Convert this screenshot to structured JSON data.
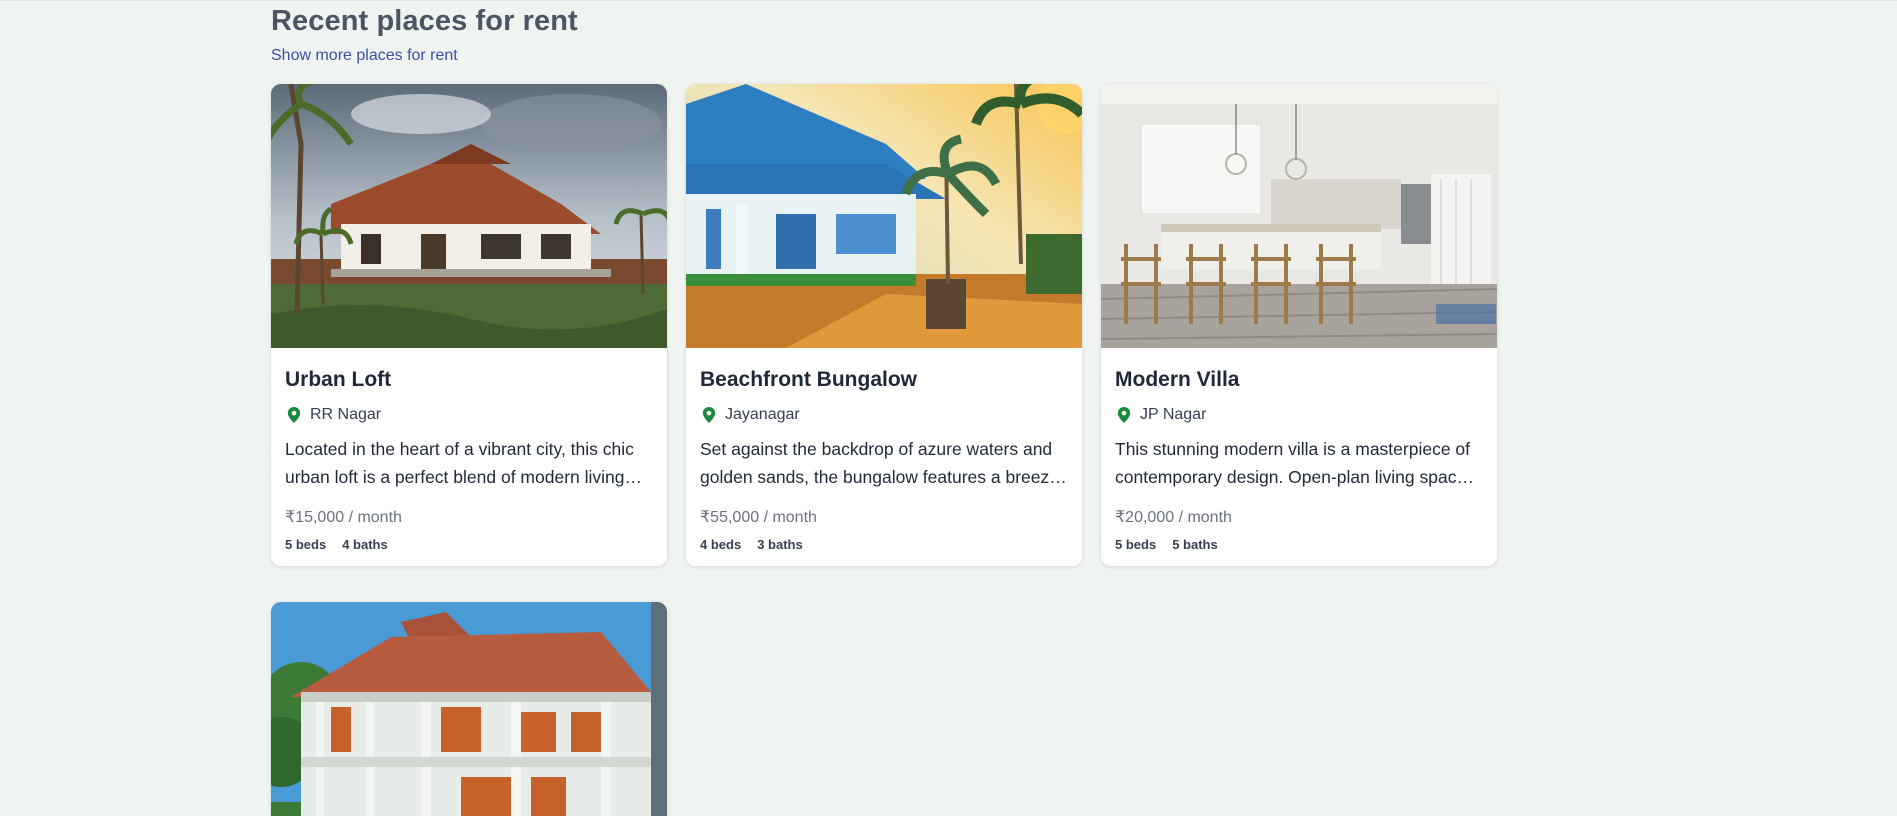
{
  "section": {
    "title": "Recent places for rent",
    "more_link": "Show more places for rent"
  },
  "listings": [
    {
      "title": "Urban Loft",
      "location": "RR Nagar",
      "description": "Located in the heart of a vibrant city, this chic urban loft is a perfect blend of modern living and industrial charm.",
      "price": "₹15,000 / month",
      "beds": "5 beds",
      "baths": "4 baths",
      "image": "tiled-roof-bungalow-photo"
    },
    {
      "title": "Beachfront Bungalow",
      "location": "Jayanagar",
      "description": "Set against the backdrop of azure waters and golden sands, the bungalow features a breezy veranda and lush gardens.",
      "price": "₹55,000 / month",
      "beds": "4 beds",
      "baths": "3 baths",
      "image": "blue-roof-cottage-photo"
    },
    {
      "title": "Modern Villa",
      "location": "JP Nagar",
      "description": "This stunning modern villa is a masterpiece of contemporary design. Open-plan living spaces with premium finishes.",
      "price": "₹20,000 / month",
      "beds": "5 beds",
      "baths": "5 baths",
      "image": "modern-kitchen-photo"
    },
    {
      "title": "",
      "location": "",
      "description": "",
      "price": "",
      "beds": "",
      "baths": "",
      "image": "heritage-mansion-photo"
    }
  ],
  "colors": {
    "background": "#f0f4f1",
    "link": "#3b4fa3",
    "pin": "#1e8a3e",
    "title": "#4b5563"
  }
}
